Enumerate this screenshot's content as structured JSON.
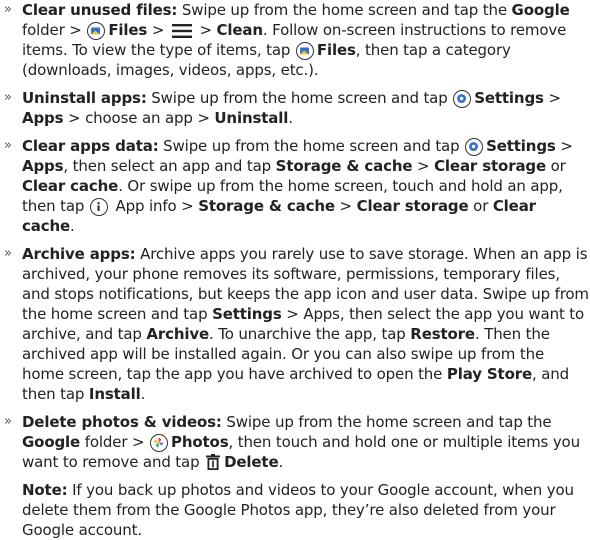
{
  "items": [
    {
      "title": "Clear unused files:",
      "t1": " Swipe up from the home screen and tap the ",
      "google": "Google",
      "t2": " folder > ",
      "files": "Files",
      "t3": " > ",
      "t4": " > ",
      "clean": "Clean",
      "t5": ". Follow on-screen instructions to remove items. To view the type of items, tap ",
      "files2": "Files",
      "t6": ", then tap a category (downloads, images, videos, apps, etc.).",
      "icons": [
        "files-app-icon",
        "menu-icon",
        "files-app-icon"
      ]
    },
    {
      "title": "Uninstall apps:",
      "t1": " Swipe up from the home screen and tap ",
      "settings": "Settings",
      "t2": " > ",
      "apps": "Apps",
      "t3": " > choose an app > ",
      "uninstall": "Uninstall",
      "t4": ".",
      "icons": [
        "settings-gear-icon"
      ]
    },
    {
      "title": "Clear apps data:",
      "t1": " Swipe up from the home screen and tap ",
      "settings": "Settings",
      "t2": " > ",
      "apps": "Apps",
      "t3": ", then select an app and tap ",
      "storage": "Storage & cache",
      "t4": " > ",
      "clear_storage": "Clear storage",
      "t5": " or ",
      "clear_cache": "Clear cache",
      "t6": ". Or swipe up from the home screen, touch and hold an app, then tap ",
      "t7": " App info > ",
      "storage2": "Storage & cache",
      "t8": " > ",
      "clear_storage2": "Clear storage",
      "t9": " or ",
      "clear_cache2": "Clear cache",
      "t10": ".",
      "icons": [
        "settings-gear-icon",
        "info-icon"
      ]
    },
    {
      "title": "Archive apps:",
      "t1": " Archive apps you rarely use to save storage. When an app is archived, your phone removes its software, permissions, temporary files, and stops notifications, but keeps the app icon and user data. Swipe up from the home screen and tap ",
      "settings": "Settings",
      "t2": " > Apps, then select the app you want to archive, and tap ",
      "archive": "Archive",
      "t3": ". To unarchive the app, tap ",
      "restore": "Restore",
      "t4": ". Then the archived app will be installed again. Or you can also swipe up from the home screen, tap the app you have archived to open the ",
      "play_store": "Play Store",
      "t5": ", and then tap ",
      "install": "Install",
      "t6": "."
    },
    {
      "title": "Delete photos & videos:",
      "t1": " Swipe up from the home screen and tap the ",
      "google": "Google",
      "t2": " folder > ",
      "photos": "Photos",
      "t3": ", then touch and hold one or multiple items you want to remove and tap ",
      "delete": "Delete",
      "t4": ".",
      "icons": [
        "photos-pinwheel-icon",
        "trash-icon"
      ]
    }
  ],
  "note": {
    "label": "Note:",
    "text": " If you back up photos and videos to your Google account, when you delete them from the Google Photos app, they’re also deleted from your Google account."
  },
  "bullet_glyph": "»",
  "colors": {
    "text": "#222222",
    "files_blue": "#2f6fd6",
    "files_yellow": "#f7c52b",
    "settings_blue": "#2f6fd6"
  }
}
